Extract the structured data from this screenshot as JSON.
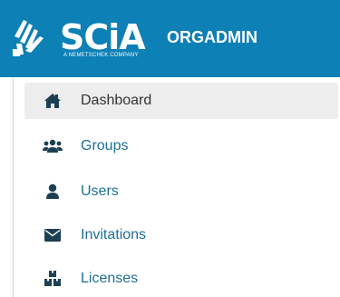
{
  "header": {
    "logo_text": "SCiA",
    "logo_tagline": "A NEMETSCHEK COMPANY",
    "org_name": "ORGADMIN",
    "background_color": "#0d80b6"
  },
  "sidebar": {
    "items": [
      {
        "label": "Dashboard",
        "icon": "home-icon",
        "active": true
      },
      {
        "label": "Groups",
        "icon": "users-group-icon",
        "active": false
      },
      {
        "label": "Users",
        "icon": "user-icon",
        "active": false
      },
      {
        "label": "Invitations",
        "icon": "envelope-icon",
        "active": false
      },
      {
        "label": "Licenses",
        "icon": "boxes-icon",
        "active": false
      }
    ],
    "active_bg": "#ededed",
    "link_color": "#1e6f94",
    "icon_color": "#1d3f52"
  }
}
